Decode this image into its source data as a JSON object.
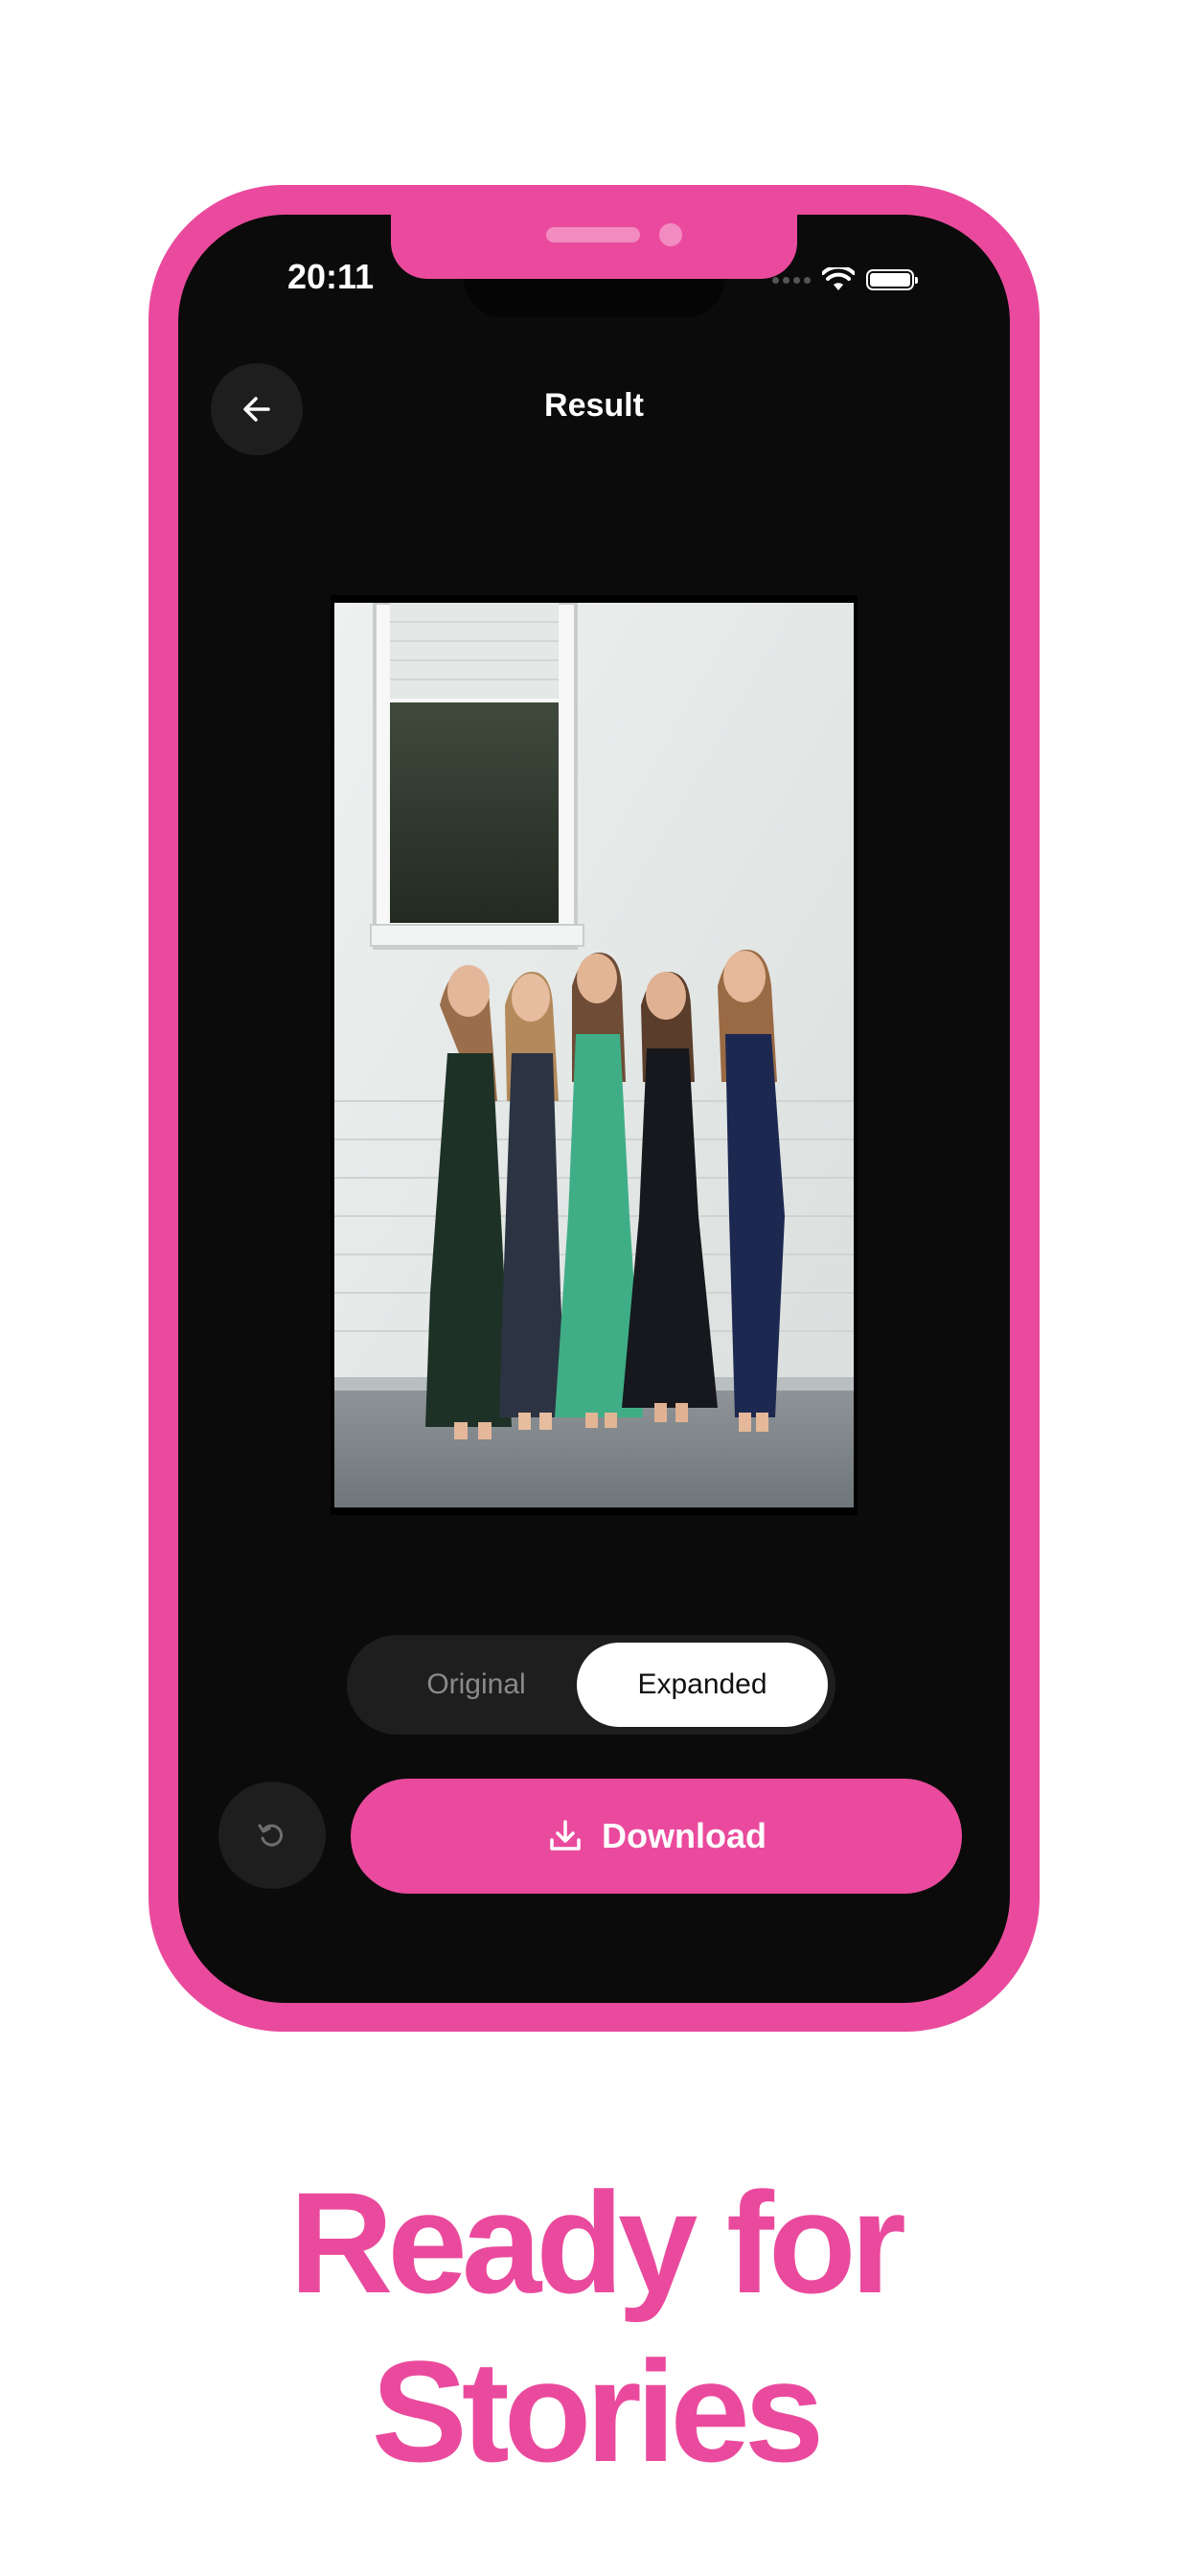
{
  "status_bar": {
    "time": "20:11"
  },
  "header": {
    "title": "Result",
    "back_icon": "arrow-left-icon"
  },
  "photo": {
    "description_icon": "result-photo"
  },
  "toggle": {
    "options": [
      "Original",
      "Expanded"
    ],
    "selected": "Expanded"
  },
  "actions": {
    "reset_icon": "undo-icon",
    "download_label": "Download",
    "download_icon": "download-icon"
  },
  "caption": {
    "line1": "Ready for",
    "line2": "Stories"
  },
  "colors": {
    "accent": "#ea4a9d",
    "screen_bg": "#0b0b0b",
    "control_bg": "#1e1e1e"
  }
}
